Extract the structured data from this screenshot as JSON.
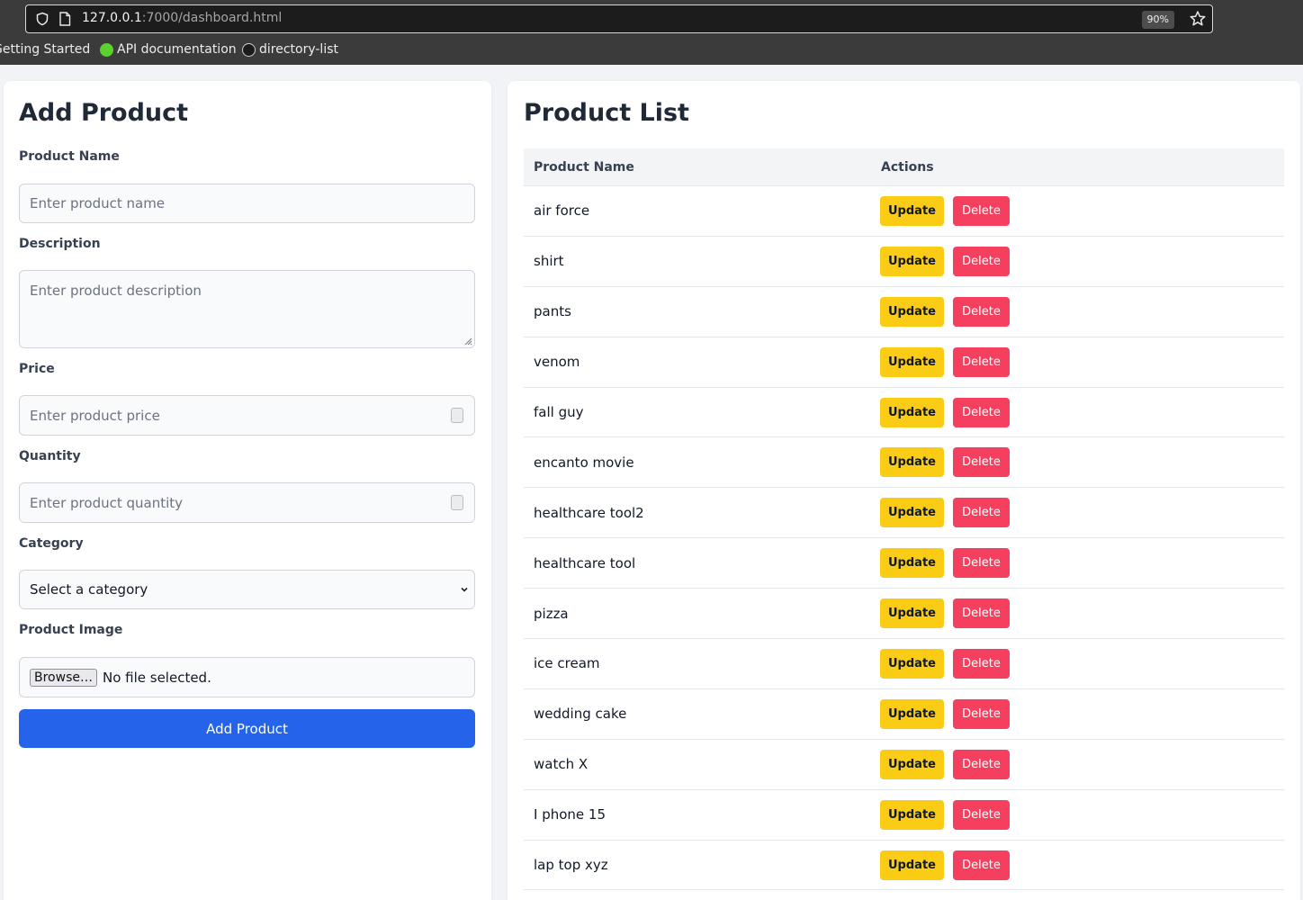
{
  "browser": {
    "url_host": "127.0.0.1",
    "url_rest": ":7000/dashboard.html",
    "zoom": "90%",
    "bookmarks": [
      {
        "label": "Getting Started"
      },
      {
        "label": "API documentation"
      },
      {
        "label": "directory-list"
      }
    ]
  },
  "form": {
    "title": "Add Product",
    "name_label": "Product Name",
    "name_placeholder": "Enter product name",
    "desc_label": "Description",
    "desc_placeholder": "Enter product description",
    "price_label": "Price",
    "price_placeholder": "Enter product price",
    "qty_label": "Quantity",
    "qty_placeholder": "Enter product quantity",
    "category_label": "Category",
    "category_value": "Select a category",
    "image_label": "Product Image",
    "browse_label": "Browse…",
    "file_status": "No file selected.",
    "submit_label": "Add Product"
  },
  "list": {
    "title": "Product List",
    "col_name": "Product Name",
    "col_actions": "Actions",
    "update_label": "Update",
    "delete_label": "Delete",
    "rows": [
      {
        "name": "air force"
      },
      {
        "name": "shirt"
      },
      {
        "name": "pants"
      },
      {
        "name": "venom"
      },
      {
        "name": "fall guy"
      },
      {
        "name": "encanto movie"
      },
      {
        "name": "healthcare tool2"
      },
      {
        "name": "healthcare tool"
      },
      {
        "name": "pizza"
      },
      {
        "name": "ice cream"
      },
      {
        "name": "wedding cake"
      },
      {
        "name": "watch X"
      },
      {
        "name": "I phone 15"
      },
      {
        "name": "lap top xyz"
      }
    ]
  },
  "colors": {
    "primary": "#2563eb",
    "update": "#facc15",
    "delete": "#f43f5e"
  }
}
